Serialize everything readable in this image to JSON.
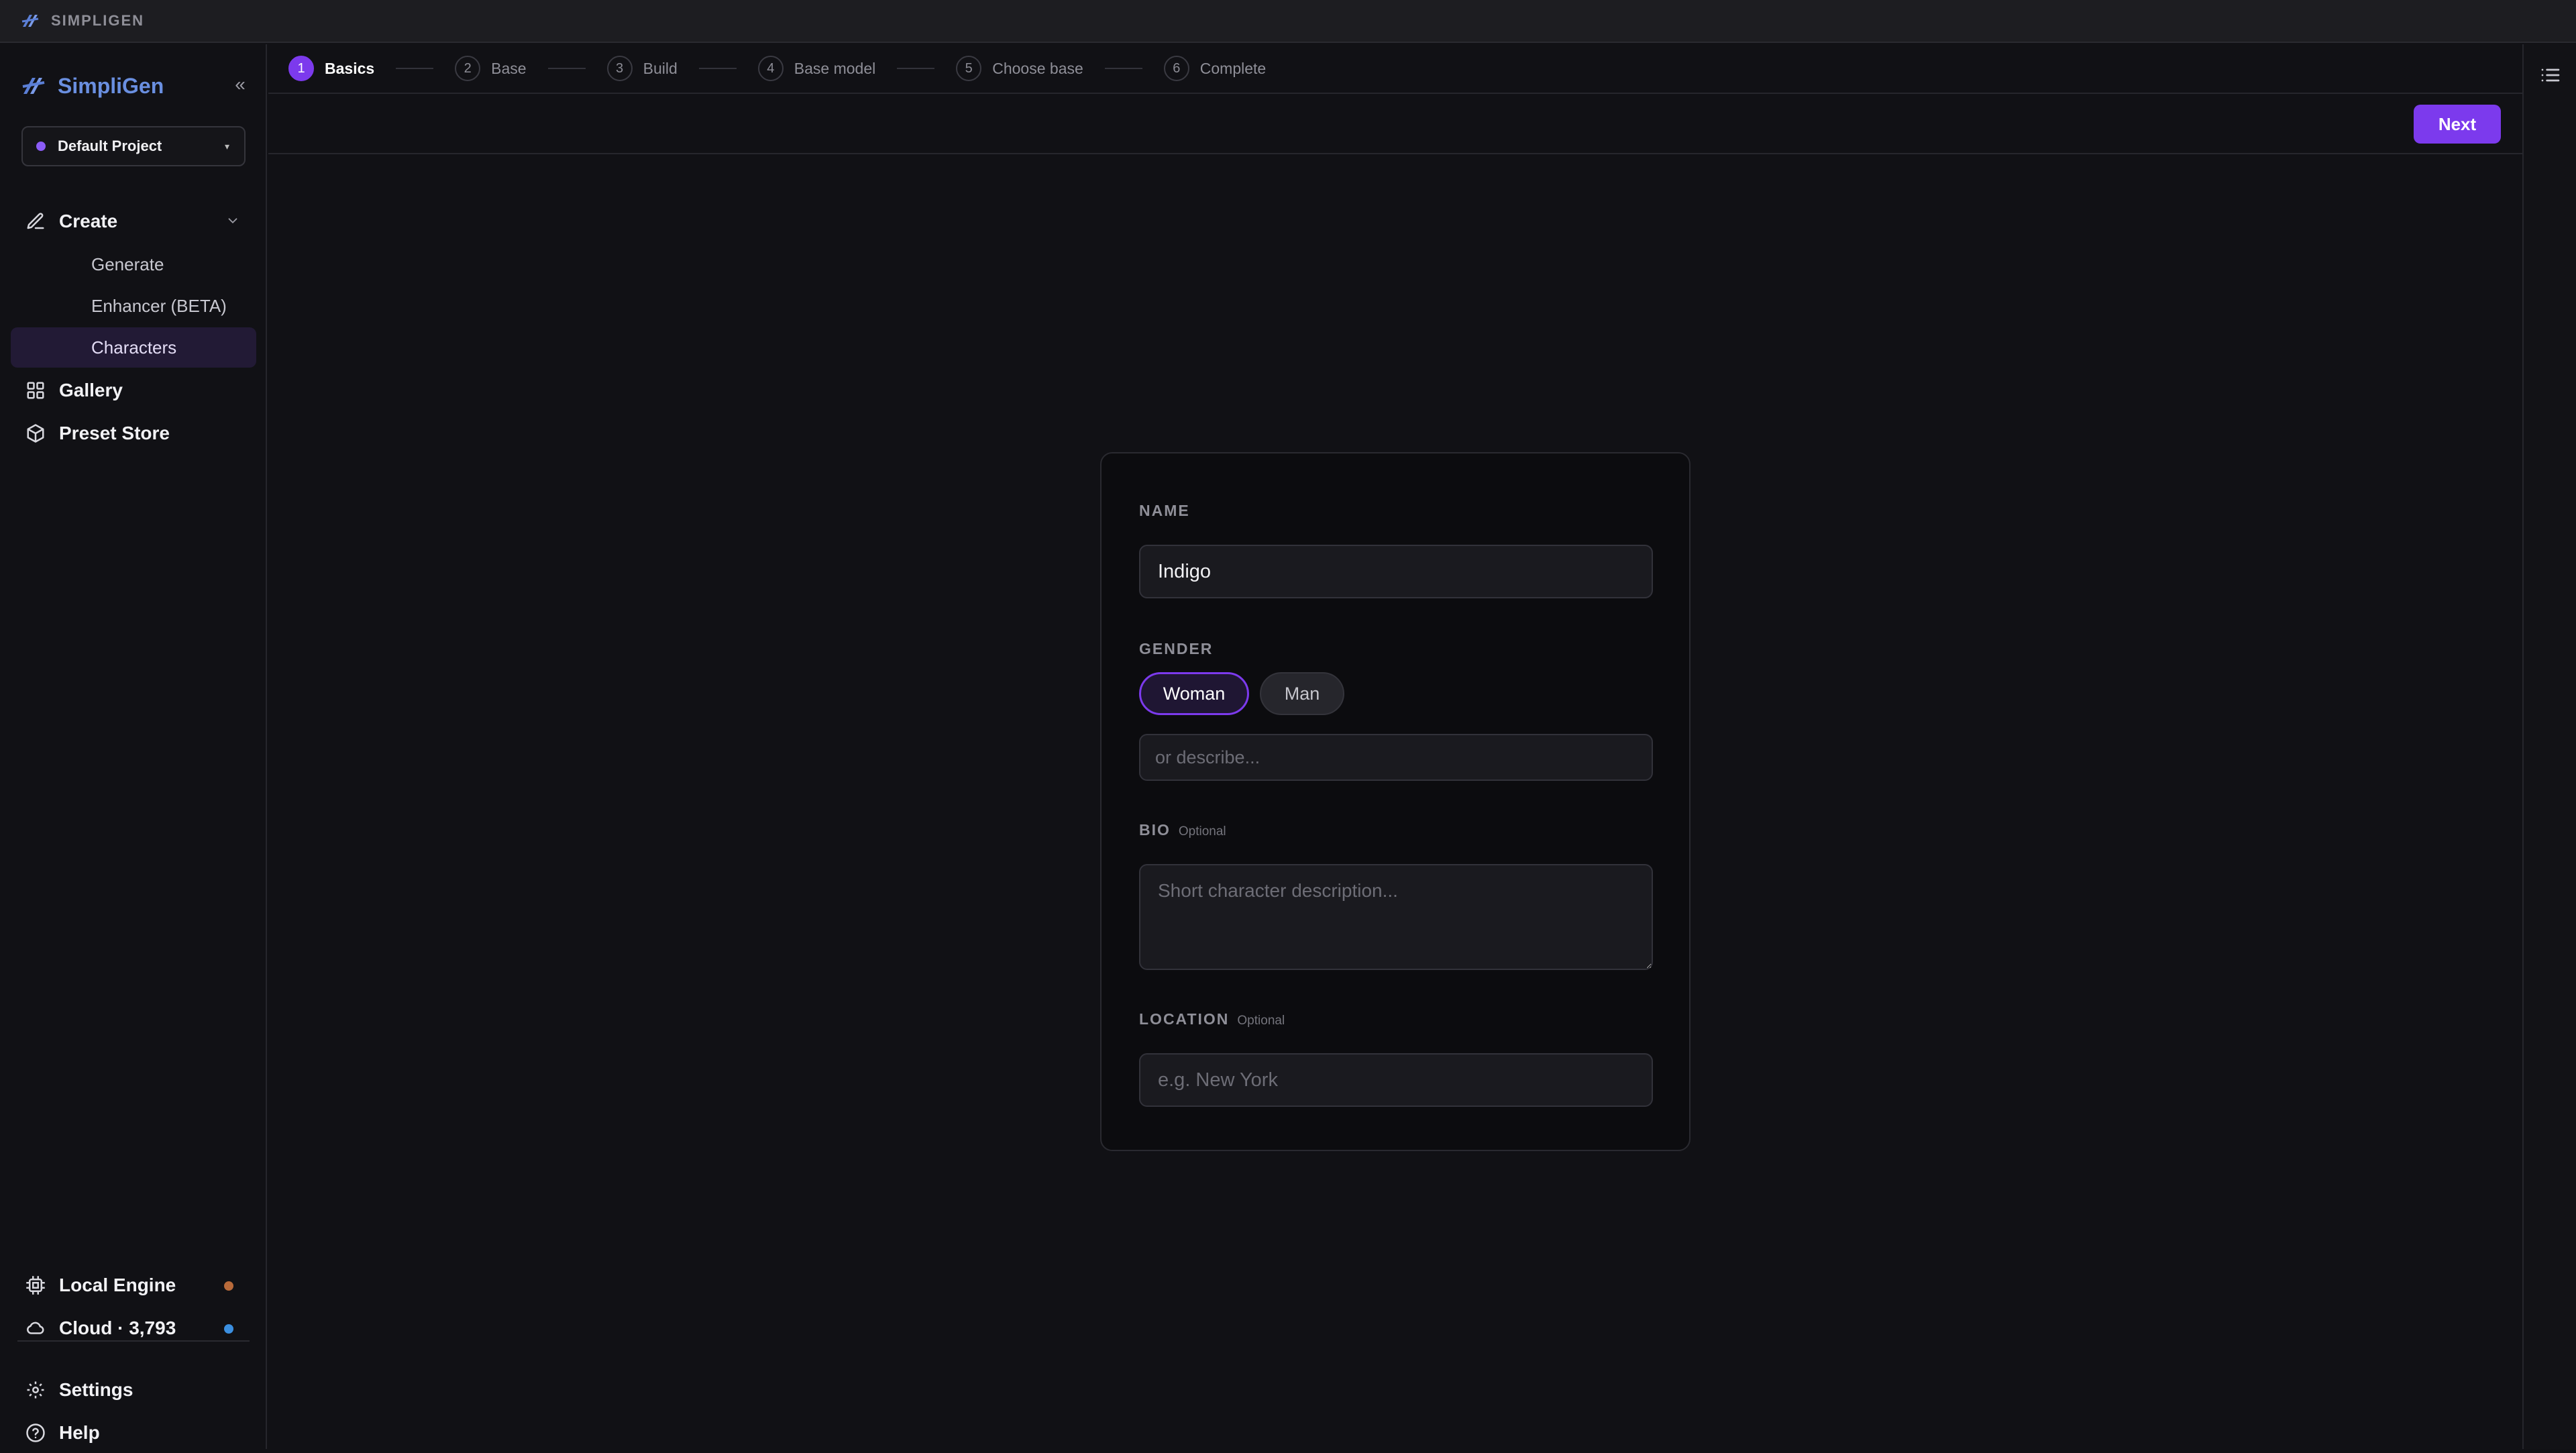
{
  "titlebar": {
    "app_title": "SIMPLIGEN"
  },
  "sidebar": {
    "brand": "SimpliGen",
    "collapse_glyph": "«",
    "project": {
      "name": "Default Project",
      "dot_color": "#8b5cf6",
      "caret": "▾"
    },
    "create": {
      "label": "Create",
      "icon": "pencil-icon"
    },
    "create_items": [
      {
        "label": "Generate"
      },
      {
        "label": "Enhancer (BETA)"
      },
      {
        "label": "Characters",
        "active": true
      }
    ],
    "gallery": {
      "label": "Gallery",
      "icon": "grid-icon"
    },
    "preset_store": {
      "label": "Preset Store",
      "icon": "box-icon"
    },
    "local_engine": {
      "label": "Local Engine",
      "status_color": "#b86a3a"
    },
    "cloud": {
      "label": "Cloud · 3,793",
      "status_color": "#3b8fe0"
    },
    "settings": {
      "label": "Settings"
    },
    "help": {
      "label": "Help"
    }
  },
  "steps": [
    {
      "num": "1",
      "label": "Basics",
      "active": true
    },
    {
      "num": "2",
      "label": "Base"
    },
    {
      "num": "3",
      "label": "Build"
    },
    {
      "num": "4",
      "label": "Base model"
    },
    {
      "num": "5",
      "label": "Choose base"
    },
    {
      "num": "6",
      "label": "Complete"
    }
  ],
  "actions": {
    "next_label": "Next"
  },
  "form": {
    "name": {
      "label": "NAME",
      "value": "Indigo"
    },
    "gender": {
      "label": "GENDER",
      "options": [
        "Woman",
        "Man"
      ],
      "selected": "Woman",
      "describe_placeholder": "or describe..."
    },
    "bio": {
      "label": "BIO",
      "optional": "Optional",
      "placeholder": "Short character description..."
    },
    "location": {
      "label": "LOCATION",
      "optional": "Optional",
      "placeholder": "e.g. New York"
    }
  },
  "colors": {
    "accent": "#7c3aed",
    "background": "#111115"
  }
}
